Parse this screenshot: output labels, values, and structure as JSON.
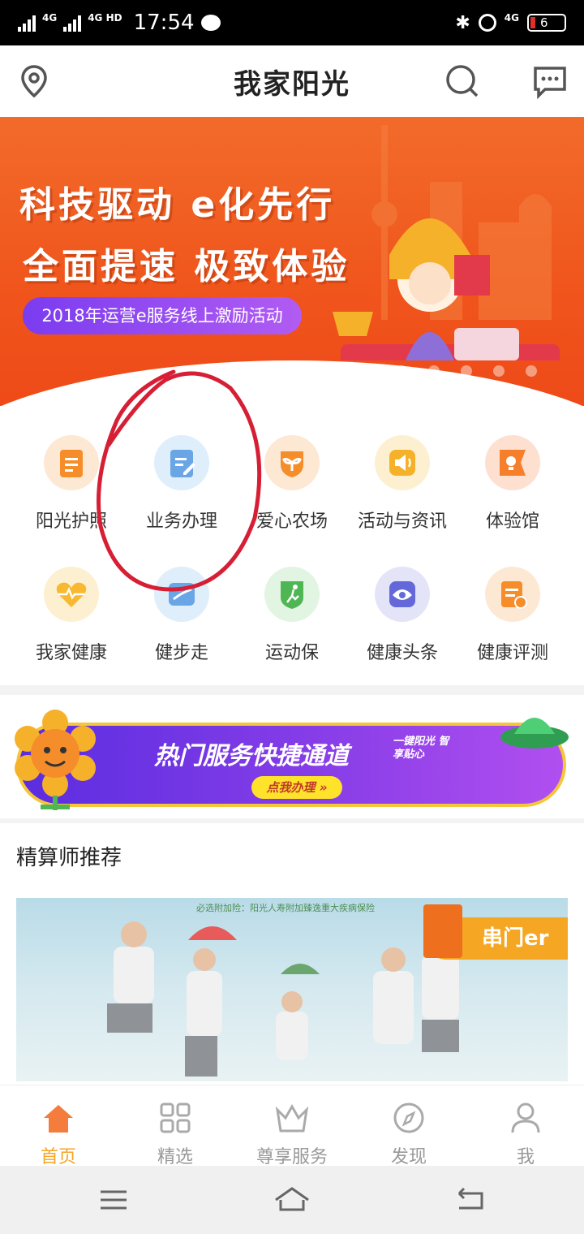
{
  "status_bar": {
    "network1": "4G",
    "network2": "4G HD",
    "time": "17:54",
    "battery": "6",
    "network3": "4G"
  },
  "header": {
    "title": "我家阳光"
  },
  "banner": {
    "line1": "科技驱动 e化先行",
    "line2": "全面提速 极致体验",
    "pill": "2018年运营e服务线上激励活动"
  },
  "grid": {
    "items": [
      {
        "label": "阳光护照",
        "icon": "clipboard-icon",
        "color": "#f58d2a"
      },
      {
        "label": "业务办理",
        "icon": "document-edit-icon",
        "color": "#6aa6e6"
      },
      {
        "label": "爱心农场",
        "icon": "sprout-icon",
        "color": "#f58d2a"
      },
      {
        "label": "活动与资讯",
        "icon": "megaphone-icon",
        "color": "#f6b12b"
      },
      {
        "label": "体验馆",
        "icon": "lightbulb-flag-icon",
        "color": "#f57f2a"
      },
      {
        "label": "我家健康",
        "icon": "heart-pulse-icon",
        "color": "#f8b830"
      },
      {
        "label": "健步走",
        "icon": "shoe-icon",
        "color": "#6aa6e6"
      },
      {
        "label": "运动保",
        "icon": "runner-shield-icon",
        "color": "#4fb654"
      },
      {
        "label": "健康头条",
        "icon": "eye-icon",
        "color": "#6468d8"
      },
      {
        "label": "健康评测",
        "icon": "checklist-icon",
        "color": "#f58d2a"
      }
    ]
  },
  "promo": {
    "text": "热门服务快捷通道",
    "sub": "一键阳光 智享贴心",
    "button": "点我办理 »"
  },
  "section": {
    "title": "精算师推荐"
  },
  "photo": {
    "caption": "必选附加险：阳光人寿附加臻逸重大疾病保险",
    "tag": "串门er"
  },
  "tabs": [
    {
      "label": "首页",
      "icon": "home-icon"
    },
    {
      "label": "精选",
      "icon": "grid-icon"
    },
    {
      "label": "尊享服务",
      "icon": "crown-icon"
    },
    {
      "label": "发现",
      "icon": "compass-icon"
    },
    {
      "label": "我",
      "icon": "user-icon"
    }
  ],
  "colors": {
    "accent": "#f5a623",
    "banner": "#f0551c",
    "annotation": "#d61f35"
  }
}
